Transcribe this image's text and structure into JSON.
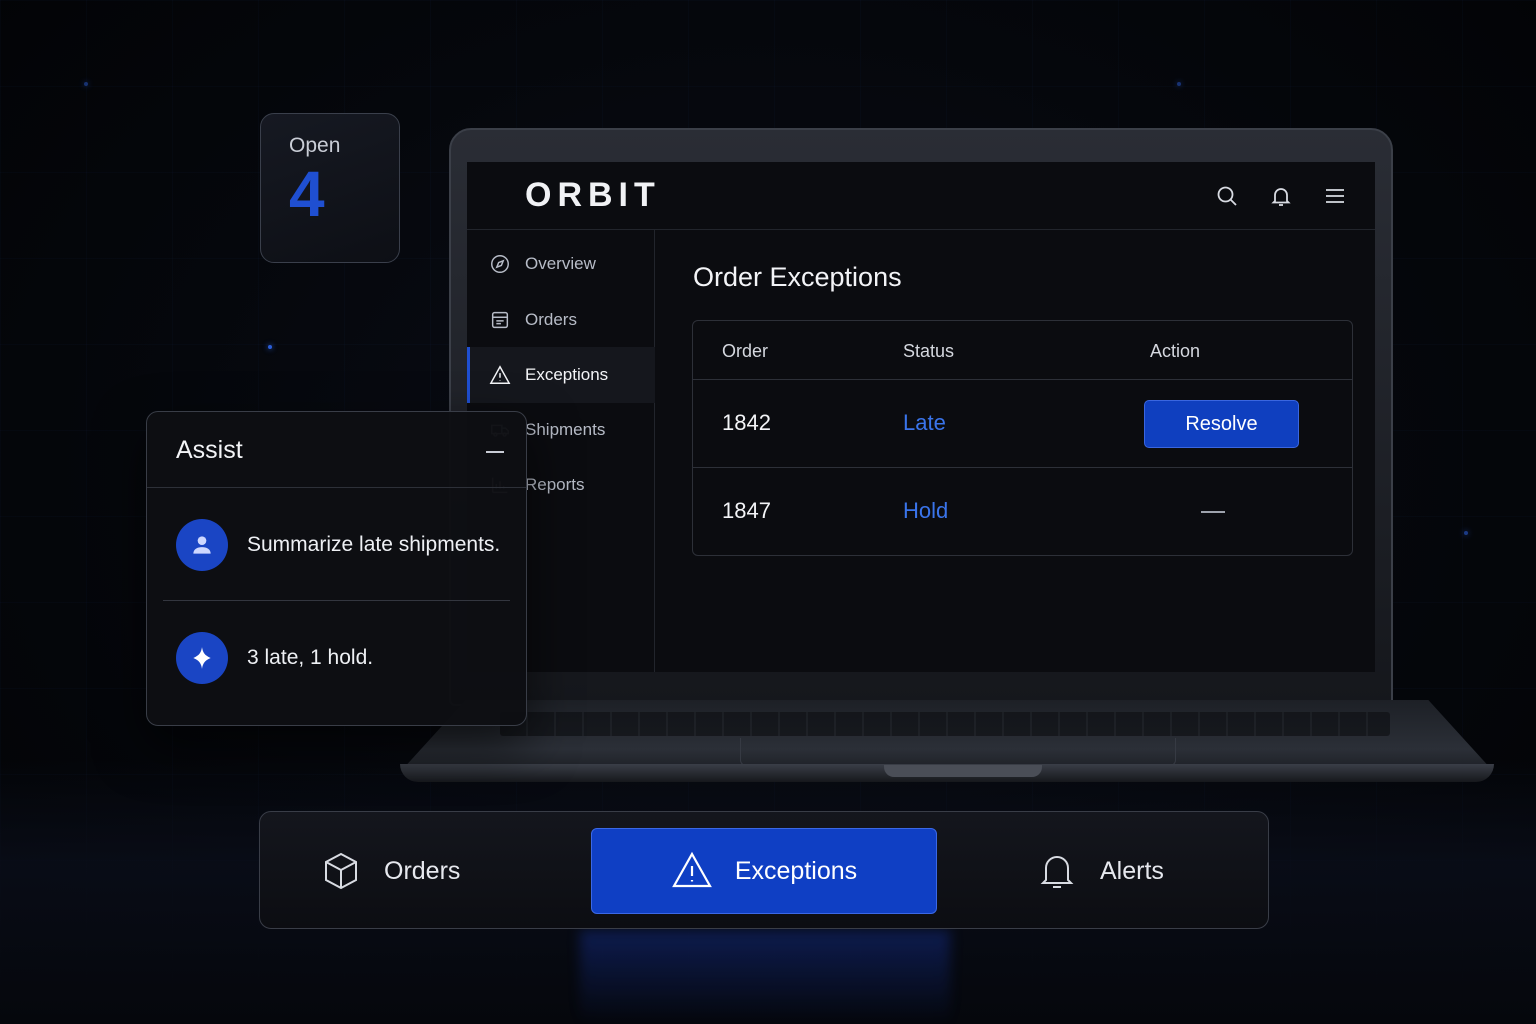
{
  "open_card": {
    "label": "Open",
    "count": "4"
  },
  "app": {
    "logo": "ORBIT",
    "top_icons": [
      "search-icon",
      "bell-icon",
      "menu-icon"
    ],
    "sidebar": {
      "items": [
        {
          "label": "Overview",
          "icon": "compass-icon",
          "active": false
        },
        {
          "label": "Orders",
          "icon": "calendar-icon",
          "active": false
        },
        {
          "label": "Exceptions",
          "icon": "warning-icon",
          "active": true
        },
        {
          "label": "Shipments",
          "icon": "truck-icon",
          "active": false
        },
        {
          "label": "Reports",
          "icon": "chart-icon",
          "active": false
        }
      ]
    },
    "main": {
      "title": "Order Exceptions",
      "columns": [
        "Order",
        "Status",
        "Action"
      ],
      "rows": [
        {
          "order": "1842",
          "status": "Late",
          "action": "Resolve"
        },
        {
          "order": "1847",
          "status": "Hold",
          "action": "—"
        }
      ]
    }
  },
  "assist": {
    "title": "Assist",
    "messages": [
      {
        "role": "user",
        "icon": "user-icon",
        "text": "Summarize late shipments."
      },
      {
        "role": "assistant",
        "icon": "sparkle-icon",
        "text": "3 late, 1 hold."
      }
    ]
  },
  "tabbar": {
    "tabs": [
      {
        "label": "Orders",
        "icon": "box-icon",
        "active": false
      },
      {
        "label": "Exceptions",
        "icon": "warning-icon",
        "active": true
      },
      {
        "label": "Alerts",
        "icon": "bell-icon",
        "active": false
      }
    ]
  },
  "colors": {
    "accent": "#0f3fc4",
    "status": "#3a74ea",
    "background": "#05070c"
  }
}
